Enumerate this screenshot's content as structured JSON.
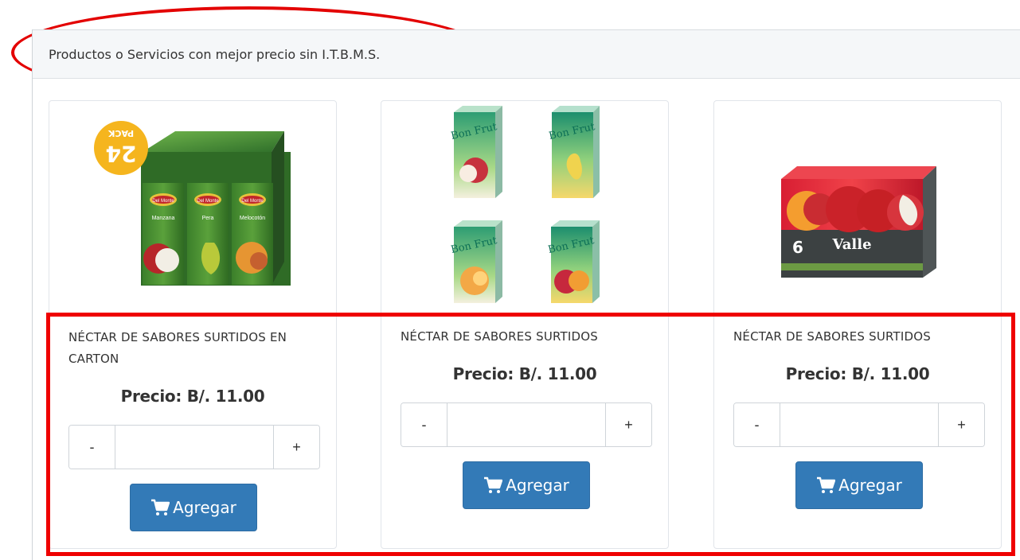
{
  "section": {
    "title": "Productos o Servicios con mejor precio sin I.T.B.M.S."
  },
  "products": [
    {
      "name": "NÉCTAR DE SABORES SURTIDOS EN CARTON",
      "price": "Precio: B/. 11.00",
      "quantity": {
        "minus": "-",
        "value": "",
        "plus": "+"
      },
      "button": "Agregar",
      "image": {
        "badge_number": "24",
        "badge_label": "PACK",
        "brand": "Del Monte",
        "flavors": [
          "Manzana",
          "Pera",
          "Melocotón"
        ]
      }
    },
    {
      "name": "NÉCTAR DE SABORES SURTIDOS",
      "price": "Precio: B/. 11.00",
      "quantity": {
        "minus": "-",
        "value": "",
        "plus": "+"
      },
      "button": "Agregar",
      "image": {
        "brand": "Bon Frut",
        "carton_count": "4"
      }
    },
    {
      "name": "NÉCTAR DE SABORES SURTIDOS",
      "price": "Precio: B/. 11.00",
      "quantity": {
        "minus": "-",
        "value": "",
        "plus": "+"
      },
      "button": "Agregar",
      "image": {
        "brand": "Valle",
        "pack_text": "6"
      }
    }
  ],
  "icons": {
    "cart": "shopping-cart-icon"
  },
  "colors": {
    "primary_button": "#337ab7",
    "annotation": "#e30000",
    "header_bg": "#f5f7f9"
  }
}
